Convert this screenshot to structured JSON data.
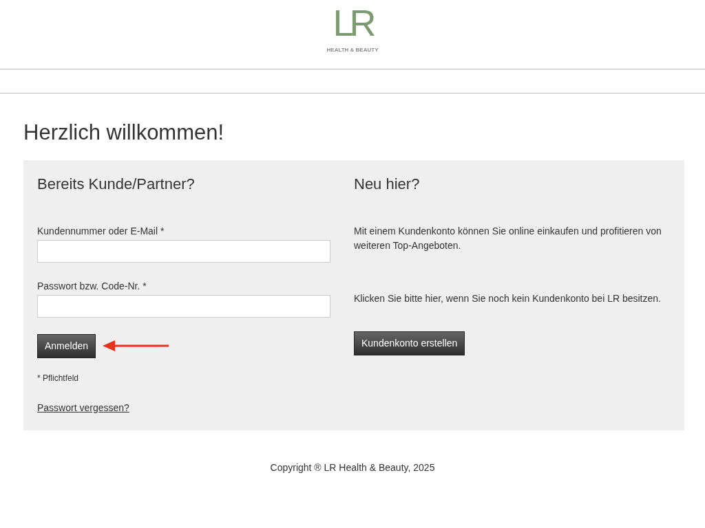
{
  "logo": {
    "mark": "LR",
    "tagline": "HEALTH & BEAUTY"
  },
  "title": "Herzlich willkommen!",
  "login": {
    "heading": "Bereits Kunde/Partner?",
    "fields": [
      {
        "label": "Kundennummer oder E-Mail *"
      },
      {
        "label": "Passwort bzw. Code-Nr. *"
      }
    ],
    "button": "Anmelden",
    "note": "* Pflichtfeld",
    "link": "Passwort vergessen?"
  },
  "register": {
    "heading": "Neu hier?",
    "paragraphs": [
      "Mit einem Kundenkonto können Sie online einkaufen und profitieren von weiteren Top-Angeboten.",
      "Klicken Sie bitte hier, wenn Sie noch kein Kundenkonto bei LR besitzen."
    ],
    "button": "Kundenkonto erstellen"
  },
  "footer": "Copyright ® LR Health & Beauty, 2025"
}
